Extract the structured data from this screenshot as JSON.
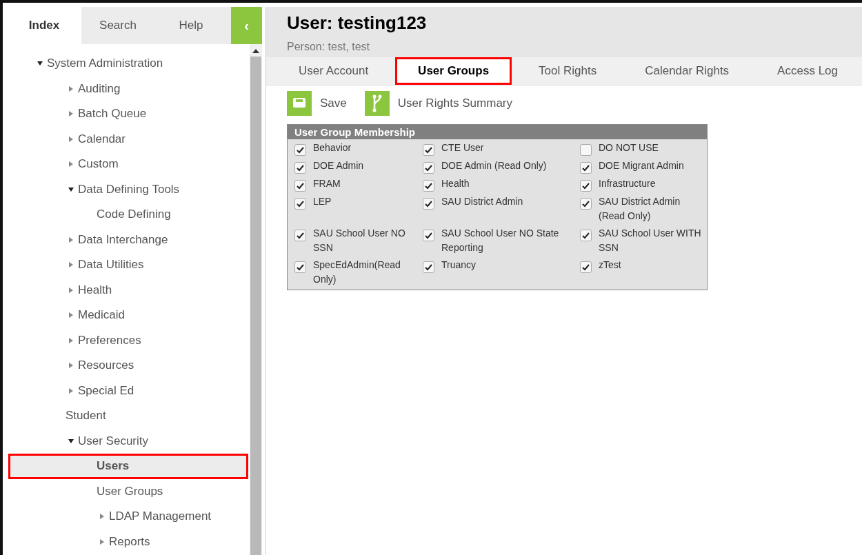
{
  "sidebar": {
    "tabs": [
      {
        "label": "Index",
        "selected": true
      },
      {
        "label": "Search",
        "selected": false
      },
      {
        "label": "Help",
        "selected": false
      }
    ],
    "collapse_button": "‹",
    "tree": [
      {
        "label": "System Administration",
        "expanded": true,
        "selected": false,
        "children": [
          {
            "label": "Auditing",
            "expanded": false,
            "selected": false
          },
          {
            "label": "Batch Queue",
            "expanded": false,
            "selected": false
          },
          {
            "label": "Calendar",
            "expanded": false,
            "selected": false
          },
          {
            "label": "Custom",
            "expanded": false,
            "selected": false
          },
          {
            "label": "Data Defining Tools",
            "expanded": true,
            "selected": false,
            "children": [
              {
                "label": "Code Defining",
                "selected": false
              }
            ]
          },
          {
            "label": "Data Interchange",
            "expanded": false,
            "selected": false
          },
          {
            "label": "Data Utilities",
            "expanded": false,
            "selected": false
          },
          {
            "label": "Health",
            "expanded": false,
            "selected": false
          },
          {
            "label": "Medicaid",
            "expanded": false,
            "selected": false
          },
          {
            "label": "Preferences",
            "expanded": false,
            "selected": false
          },
          {
            "label": "Resources",
            "expanded": false,
            "selected": false
          },
          {
            "label": "Special Ed",
            "expanded": false,
            "selected": false
          },
          {
            "label": "Student",
            "selected": false
          },
          {
            "label": "User Security",
            "expanded": true,
            "selected": false,
            "children": [
              {
                "label": "Users",
                "selected": true
              },
              {
                "label": "User Groups",
                "selected": false
              },
              {
                "label": "LDAP Management",
                "expanded": false,
                "selected": false
              },
              {
                "label": "Reports",
                "expanded": false,
                "selected": false
              }
            ]
          }
        ]
      }
    ]
  },
  "header": {
    "title": "User: testing123",
    "subtitle": "Person: test, test"
  },
  "tabs": [
    {
      "label": "User Account",
      "selected": false
    },
    {
      "label": "User Groups",
      "selected": true
    },
    {
      "label": "Tool Rights",
      "selected": false
    },
    {
      "label": "Calendar Rights",
      "selected": false
    },
    {
      "label": "Access Log",
      "selected": false
    }
  ],
  "toolbar": [
    {
      "kind": "save",
      "label": "Save"
    },
    {
      "kind": "summary",
      "label": "User Rights Summary"
    }
  ],
  "membership": {
    "title": "User Group Membership",
    "groups": [
      {
        "label": "Behavior",
        "checked": true
      },
      {
        "label": "CTE User",
        "checked": true
      },
      {
        "label": "DO NOT USE",
        "checked": false
      },
      {
        "label": "DOE Admin",
        "checked": true
      },
      {
        "label": "DOE Admin (Read Only)",
        "checked": true
      },
      {
        "label": "DOE Migrant Admin",
        "checked": true
      },
      {
        "label": "FRAM",
        "checked": true
      },
      {
        "label": "Health",
        "checked": true
      },
      {
        "label": "Infrastructure",
        "checked": true
      },
      {
        "label": "LEP",
        "checked": true
      },
      {
        "label": "SAU District Admin",
        "checked": true
      },
      {
        "label": "SAU District Admin (Read Only)",
        "checked": true
      },
      {
        "label": "SAU School User NO SSN",
        "checked": true
      },
      {
        "label": "SAU School User NO State Reporting",
        "checked": true
      },
      {
        "label": "SAU School User WITH SSN",
        "checked": true
      },
      {
        "label": "SpecEdAdmin(Read Only)",
        "checked": true
      },
      {
        "label": "Truancy",
        "checked": true
      },
      {
        "label": "zTest",
        "checked": true
      }
    ]
  }
}
